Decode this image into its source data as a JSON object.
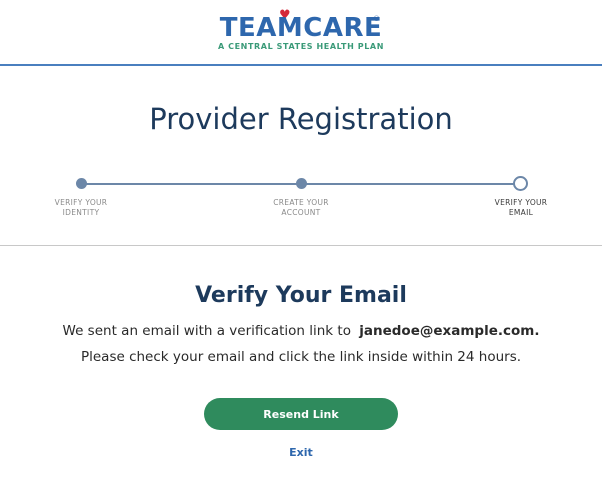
{
  "header": {
    "logo_word": "TEAMCARE",
    "logo_registered": "®",
    "logo_heart": "♥",
    "logo_tagline": "A CENTRAL STATES HEALTH PLAN"
  },
  "page": {
    "title": "Provider Registration"
  },
  "stepper": {
    "steps": [
      {
        "line1": "VERIFY YOUR",
        "line2": "IDENTITY",
        "state": "complete"
      },
      {
        "line1": "CREATE YOUR",
        "line2": "ACCOUNT",
        "state": "complete"
      },
      {
        "line1": "VERIFY YOUR",
        "line2": "EMAIL",
        "state": "current"
      }
    ]
  },
  "content": {
    "heading": "Verify Your Email",
    "sent_text": "We sent an email with a verification link to",
    "email": "janedoe@example.com.",
    "instructions": "Please check your email and click the link inside within 24 hours.",
    "resend_label": "Resend Link",
    "exit_label": "Exit"
  },
  "colors": {
    "brand_blue": "#2e67ad",
    "heart_red": "#d4283a",
    "tagline_green": "#3a9a78",
    "navy_text": "#1d3a5c",
    "button_green": "#2f8b5d",
    "stepper_gray_blue": "#6c87a8"
  }
}
